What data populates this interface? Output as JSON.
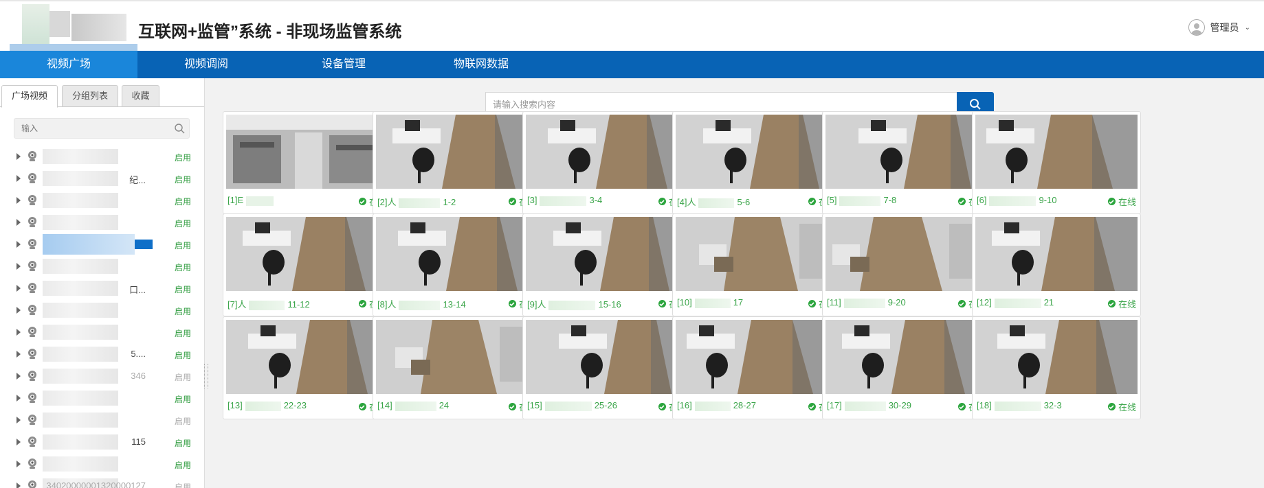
{
  "header": {
    "title": "互联网+监管”系统 - 非现场监管系统",
    "user_name": "管理员"
  },
  "nav": {
    "items": [
      {
        "label": "视频广场",
        "active": true
      },
      {
        "label": "视频调阅",
        "active": false
      },
      {
        "label": "设备管理",
        "active": false
      },
      {
        "label": "物联网数据",
        "active": false
      }
    ]
  },
  "sidebar": {
    "tabs": [
      {
        "label": "广场视频",
        "active": true
      },
      {
        "label": "分组列表",
        "active": false
      },
      {
        "label": "收藏",
        "active": false
      }
    ],
    "search_placeholder": "输入",
    "tree": [
      {
        "label": "",
        "status": "启用",
        "enabled": true
      },
      {
        "label": "纪...",
        "status": "启用",
        "enabled": true
      },
      {
        "label": "",
        "status": "启用",
        "enabled": true
      },
      {
        "label": "",
        "status": "启用",
        "enabled": true
      },
      {
        "label": "",
        "status": "启用",
        "enabled": true,
        "selected": true
      },
      {
        "label": "",
        "status": "启用",
        "enabled": true
      },
      {
        "label": "口...",
        "status": "启用",
        "enabled": true
      },
      {
        "label": "",
        "status": "启用",
        "enabled": true
      },
      {
        "label": "",
        "status": "启用",
        "enabled": true
      },
      {
        "label": "5....",
        "status": "启用",
        "enabled": true
      },
      {
        "label": "346",
        "status": "启用",
        "enabled": false
      },
      {
        "label": "",
        "status": "启用",
        "enabled": true
      },
      {
        "label": "",
        "status": "启用",
        "enabled": false
      },
      {
        "label": "115",
        "status": "启用",
        "enabled": true
      },
      {
        "label": "",
        "status": "启用",
        "enabled": true
      },
      {
        "label": "34020000001320000127",
        "status": "启用",
        "enabled": false
      }
    ]
  },
  "main": {
    "search_placeholder": "请输入搜索内容",
    "cameras": [
      {
        "name": "[1]E",
        "status": "在线",
        "scene": "office"
      },
      {
        "name": "[2]人",
        "suffix": "1-2",
        "status": "在线",
        "scene": "desk"
      },
      {
        "name": "[3]",
        "suffix": "3-4",
        "status": "在线",
        "scene": "desk"
      },
      {
        "name": "[4]人",
        "suffix": "5-6",
        "status": "在线",
        "scene": "desk"
      },
      {
        "name": "[5]",
        "suffix": "7-8",
        "status": "在线",
        "scene": "desk"
      },
      {
        "name": "[6]",
        "suffix": "9-10",
        "status": "在线",
        "scene": "desk"
      },
      {
        "name": "[7]人",
        "suffix": "11-12",
        "status": "在线",
        "scene": "desk"
      },
      {
        "name": "[8]人",
        "suffix": "13-14",
        "status": "在线",
        "scene": "desk"
      },
      {
        "name": "[9]人",
        "suffix": "15-16",
        "status": "在线",
        "scene": "desk"
      },
      {
        "name": "[10]",
        "suffix": "17",
        "status": "在线",
        "scene": "floor"
      },
      {
        "name": "[11]",
        "suffix": "9-20",
        "status": "在线",
        "scene": "floor"
      },
      {
        "name": "[12]",
        "suffix": "21",
        "status": "在线",
        "scene": "desk"
      },
      {
        "name": "[13]",
        "suffix": "22-23",
        "status": "在线",
        "scene": "desk"
      },
      {
        "name": "[14]",
        "suffix": "24",
        "status": "在线",
        "scene": "floor"
      },
      {
        "name": "[15]",
        "suffix": "25-26",
        "status": "在线",
        "scene": "desk"
      },
      {
        "name": "[16]",
        "suffix": "28-27",
        "status": "在线",
        "scene": "desk"
      },
      {
        "name": "[17]",
        "suffix": "30-29",
        "status": "在线",
        "scene": "desk"
      },
      {
        "name": "[18]",
        "suffix": "32-3",
        "status": "在线",
        "scene": "desk"
      }
    ]
  },
  "colors": {
    "nav_bg": "#0863b5",
    "nav_active": "#1a86da",
    "online_green": "#3ba54a"
  }
}
